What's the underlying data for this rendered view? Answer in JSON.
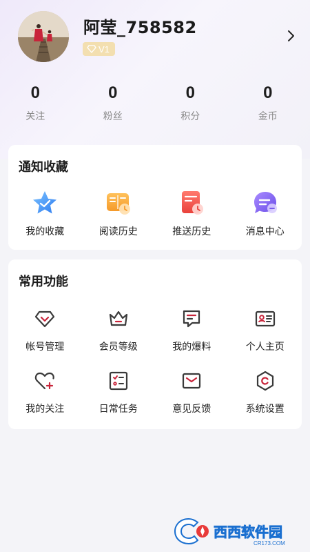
{
  "profile": {
    "username": "阿莹_758582",
    "vip_level": "V1"
  },
  "stats": [
    {
      "value": "0",
      "label": "关注"
    },
    {
      "value": "0",
      "label": "粉丝"
    },
    {
      "value": "0",
      "label": "积分"
    },
    {
      "value": "0",
      "label": "金币"
    }
  ],
  "notifications": {
    "title": "通知收藏",
    "items": [
      {
        "label": "我的收藏",
        "icon": "star-icon"
      },
      {
        "label": "阅读历史",
        "icon": "book-clock-icon"
      },
      {
        "label": "推送历史",
        "icon": "document-clock-icon"
      },
      {
        "label": "消息中心",
        "icon": "chat-bubble-icon"
      }
    ]
  },
  "functions": {
    "title": "常用功能",
    "items": [
      {
        "label": "帐号管理",
        "icon": "diamond-check-icon"
      },
      {
        "label": "会员等级",
        "icon": "crown-icon"
      },
      {
        "label": "我的爆料",
        "icon": "message-icon"
      },
      {
        "label": "个人主页",
        "icon": "id-card-icon"
      },
      {
        "label": "我的关注",
        "icon": "heart-plus-icon"
      },
      {
        "label": "日常任务",
        "icon": "checklist-icon"
      },
      {
        "label": "意见反馈",
        "icon": "envelope-icon"
      },
      {
        "label": "系统设置",
        "icon": "settings-icon"
      }
    ]
  },
  "watermark": {
    "main": "西西软件园",
    "sub": "CR173.COM"
  },
  "colors": {
    "accent_red": "#c8243a",
    "icon_dark": "#3a3a3a",
    "vip_gold": "#f3dfb0"
  }
}
